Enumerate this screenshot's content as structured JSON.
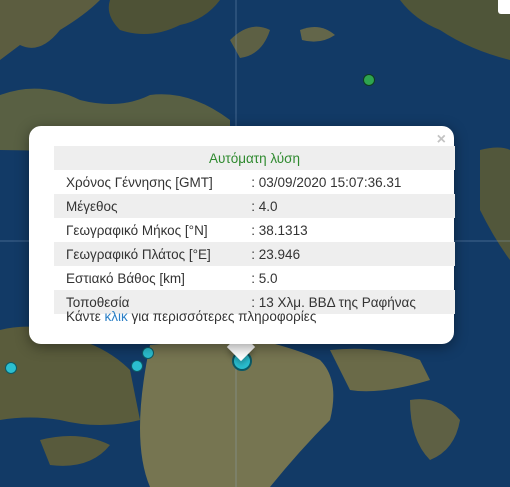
{
  "popup": {
    "title": "Αυτόματη λύση",
    "close_symbol": "×",
    "rows": [
      {
        "label": "Χρόνος Γέννησης [GMT]",
        "value": ": 03/09/2020 15:07:36.31"
      },
      {
        "label": "Μέγεθος",
        "value": ": 4.0"
      },
      {
        "label": "Γεωγραφικό Μήκος [°N]",
        "value": ": 38.1313"
      },
      {
        "label": "Γεωγραφικό Πλάτος [°E]",
        "value": ": 23.946"
      },
      {
        "label": "Εστιακό Βάθος [km]",
        "value": ": 5.0"
      },
      {
        "label": "Τοποθεσία",
        "value": ": 13 Χλμ. ΒΒΔ της Ραφήνας"
      }
    ],
    "more_prefix": "Κάντε ",
    "more_link": "κλικ",
    "more_suffix": " για περισσότερες πληροφορίες"
  },
  "colors": {
    "title_green": "#2f8a2f",
    "link_blue": "#2a7fc6",
    "marker_green": "#2ea44f",
    "marker_cyan": "#2bbfd0"
  }
}
